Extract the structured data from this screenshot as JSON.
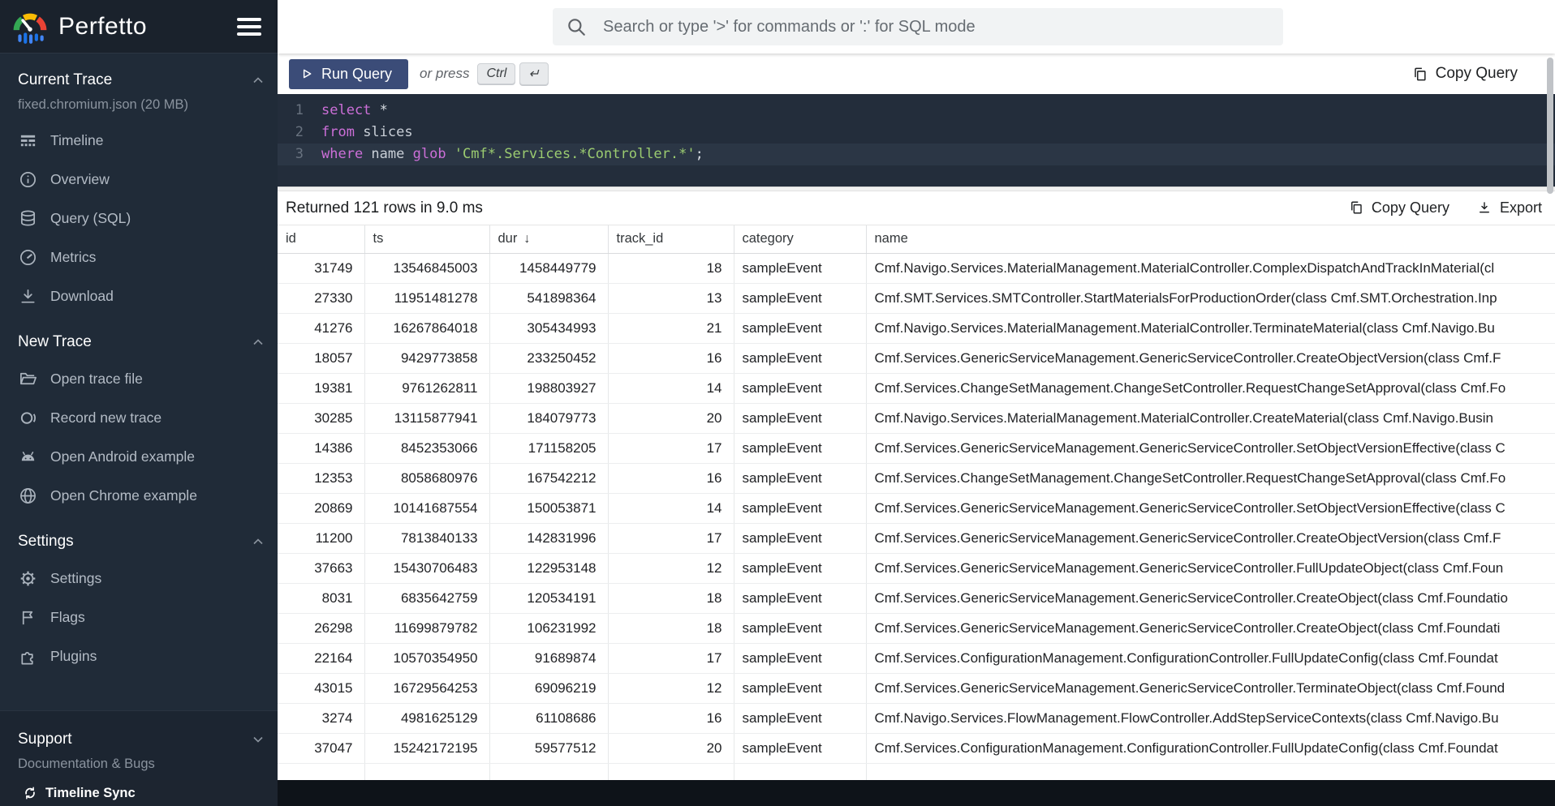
{
  "app": {
    "title": "Perfetto"
  },
  "topbar": {
    "search_placeholder": "Search or type '>' for commands or ':' for SQL mode"
  },
  "query_bar": {
    "run_label": "Run Query",
    "or_press": "or press",
    "key1": "Ctrl",
    "key2": "↵",
    "copy_label": "Copy Query"
  },
  "sql": {
    "line1_no": "1",
    "line1_kw": "select",
    "line1_rest": " *",
    "line2_no": "2",
    "line2_kw": "from",
    "line2_rest": " slices",
    "line3_no": "3",
    "line3_kw1": "where",
    "line3_id": " name ",
    "line3_kw2": "glob",
    "line3_str": " 'Cmf*.Services.*Controller.*'",
    "line3_end": ";"
  },
  "sidebar": {
    "sections": [
      {
        "title": "Current Trace",
        "subtitle": "fixed.chromium.json (20 MB)",
        "items": [
          {
            "label": "Timeline"
          },
          {
            "label": "Overview"
          },
          {
            "label": "Query (SQL)"
          },
          {
            "label": "Metrics"
          },
          {
            "label": "Download"
          }
        ]
      },
      {
        "title": "New Trace",
        "items": [
          {
            "label": "Open trace file"
          },
          {
            "label": "Record new trace"
          },
          {
            "label": "Open Android example"
          },
          {
            "label": "Open Chrome example"
          }
        ]
      },
      {
        "title": "Settings",
        "items": [
          {
            "label": "Settings"
          },
          {
            "label": "Flags"
          },
          {
            "label": "Plugins"
          }
        ]
      },
      {
        "title": "Support",
        "subtitle": "Documentation & Bugs",
        "items": []
      }
    ]
  },
  "statusbar": {
    "timeline_sync": "Timeline Sync"
  },
  "results": {
    "summary": "Returned 121 rows in 9.0 ms",
    "copy_label": "Copy Query",
    "export_label": "Export",
    "columns": [
      "id",
      "ts",
      "dur",
      "track_id",
      "category",
      "name"
    ],
    "sort_arrow": "↓",
    "rows": [
      {
        "id": "31749",
        "ts": "13546845003",
        "dur": "1458449779",
        "track_id": "18",
        "category": "sampleEvent",
        "name": "Cmf.Navigo.Services.MaterialManagement.MaterialController.ComplexDispatchAndTrackInMaterial(cl"
      },
      {
        "id": "27330",
        "ts": "11951481278",
        "dur": "541898364",
        "track_id": "13",
        "category": "sampleEvent",
        "name": "Cmf.SMT.Services.SMTController.StartMaterialsForProductionOrder(class Cmf.SMT.Orchestration.Inp"
      },
      {
        "id": "41276",
        "ts": "16267864018",
        "dur": "305434993",
        "track_id": "21",
        "category": "sampleEvent",
        "name": "Cmf.Navigo.Services.MaterialManagement.MaterialController.TerminateMaterial(class Cmf.Navigo.Bu"
      },
      {
        "id": "18057",
        "ts": "9429773858",
        "dur": "233250452",
        "track_id": "16",
        "category": "sampleEvent",
        "name": "Cmf.Services.GenericServiceManagement.GenericServiceController.CreateObjectVersion(class Cmf.F"
      },
      {
        "id": "19381",
        "ts": "9761262811",
        "dur": "198803927",
        "track_id": "14",
        "category": "sampleEvent",
        "name": "Cmf.Services.ChangeSetManagement.ChangeSetController.RequestChangeSetApproval(class Cmf.Fo"
      },
      {
        "id": "30285",
        "ts": "13115877941",
        "dur": "184079773",
        "track_id": "20",
        "category": "sampleEvent",
        "name": "Cmf.Navigo.Services.MaterialManagement.MaterialController.CreateMaterial(class Cmf.Navigo.Busin"
      },
      {
        "id": "14386",
        "ts": "8452353066",
        "dur": "171158205",
        "track_id": "17",
        "category": "sampleEvent",
        "name": "Cmf.Services.GenericServiceManagement.GenericServiceController.SetObjectVersionEffective(class C"
      },
      {
        "id": "12353",
        "ts": "8058680976",
        "dur": "167542212",
        "track_id": "16",
        "category": "sampleEvent",
        "name": "Cmf.Services.ChangeSetManagement.ChangeSetController.RequestChangeSetApproval(class Cmf.Fo"
      },
      {
        "id": "20869",
        "ts": "10141687554",
        "dur": "150053871",
        "track_id": "14",
        "category": "sampleEvent",
        "name": "Cmf.Services.GenericServiceManagement.GenericServiceController.SetObjectVersionEffective(class C"
      },
      {
        "id": "11200",
        "ts": "7813840133",
        "dur": "142831996",
        "track_id": "17",
        "category": "sampleEvent",
        "name": "Cmf.Services.GenericServiceManagement.GenericServiceController.CreateObjectVersion(class Cmf.F"
      },
      {
        "id": "37663",
        "ts": "15430706483",
        "dur": "122953148",
        "track_id": "12",
        "category": "sampleEvent",
        "name": "Cmf.Services.GenericServiceManagement.GenericServiceController.FullUpdateObject(class Cmf.Foun"
      },
      {
        "id": "8031",
        "ts": "6835642759",
        "dur": "120534191",
        "track_id": "18",
        "category": "sampleEvent",
        "name": "Cmf.Services.GenericServiceManagement.GenericServiceController.CreateObject(class Cmf.Foundatio"
      },
      {
        "id": "26298",
        "ts": "11699879782",
        "dur": "106231992",
        "track_id": "18",
        "category": "sampleEvent",
        "name": "Cmf.Services.GenericServiceManagement.GenericServiceController.CreateObject(class Cmf.Foundati"
      },
      {
        "id": "22164",
        "ts": "10570354950",
        "dur": "91689874",
        "track_id": "17",
        "category": "sampleEvent",
        "name": "Cmf.Services.ConfigurationManagement.ConfigurationController.FullUpdateConfig(class Cmf.Foundat"
      },
      {
        "id": "43015",
        "ts": "16729564253",
        "dur": "69096219",
        "track_id": "12",
        "category": "sampleEvent",
        "name": "Cmf.Services.GenericServiceManagement.GenericServiceController.TerminateObject(class Cmf.Found"
      },
      {
        "id": "3274",
        "ts": "4981625129",
        "dur": "61108686",
        "track_id": "16",
        "category": "sampleEvent",
        "name": "Cmf.Navigo.Services.FlowManagement.FlowController.AddStepServiceContexts(class Cmf.Navigo.Bu"
      },
      {
        "id": "37047",
        "ts": "15242172195",
        "dur": "59577512",
        "track_id": "20",
        "category": "sampleEvent",
        "name": "Cmf.Services.ConfigurationManagement.ConfigurationController.FullUpdateConfig(class Cmf.Foundat"
      },
      {
        "id": "",
        "ts": "",
        "dur": "",
        "track_id": "",
        "category": "",
        "name": ""
      }
    ]
  }
}
